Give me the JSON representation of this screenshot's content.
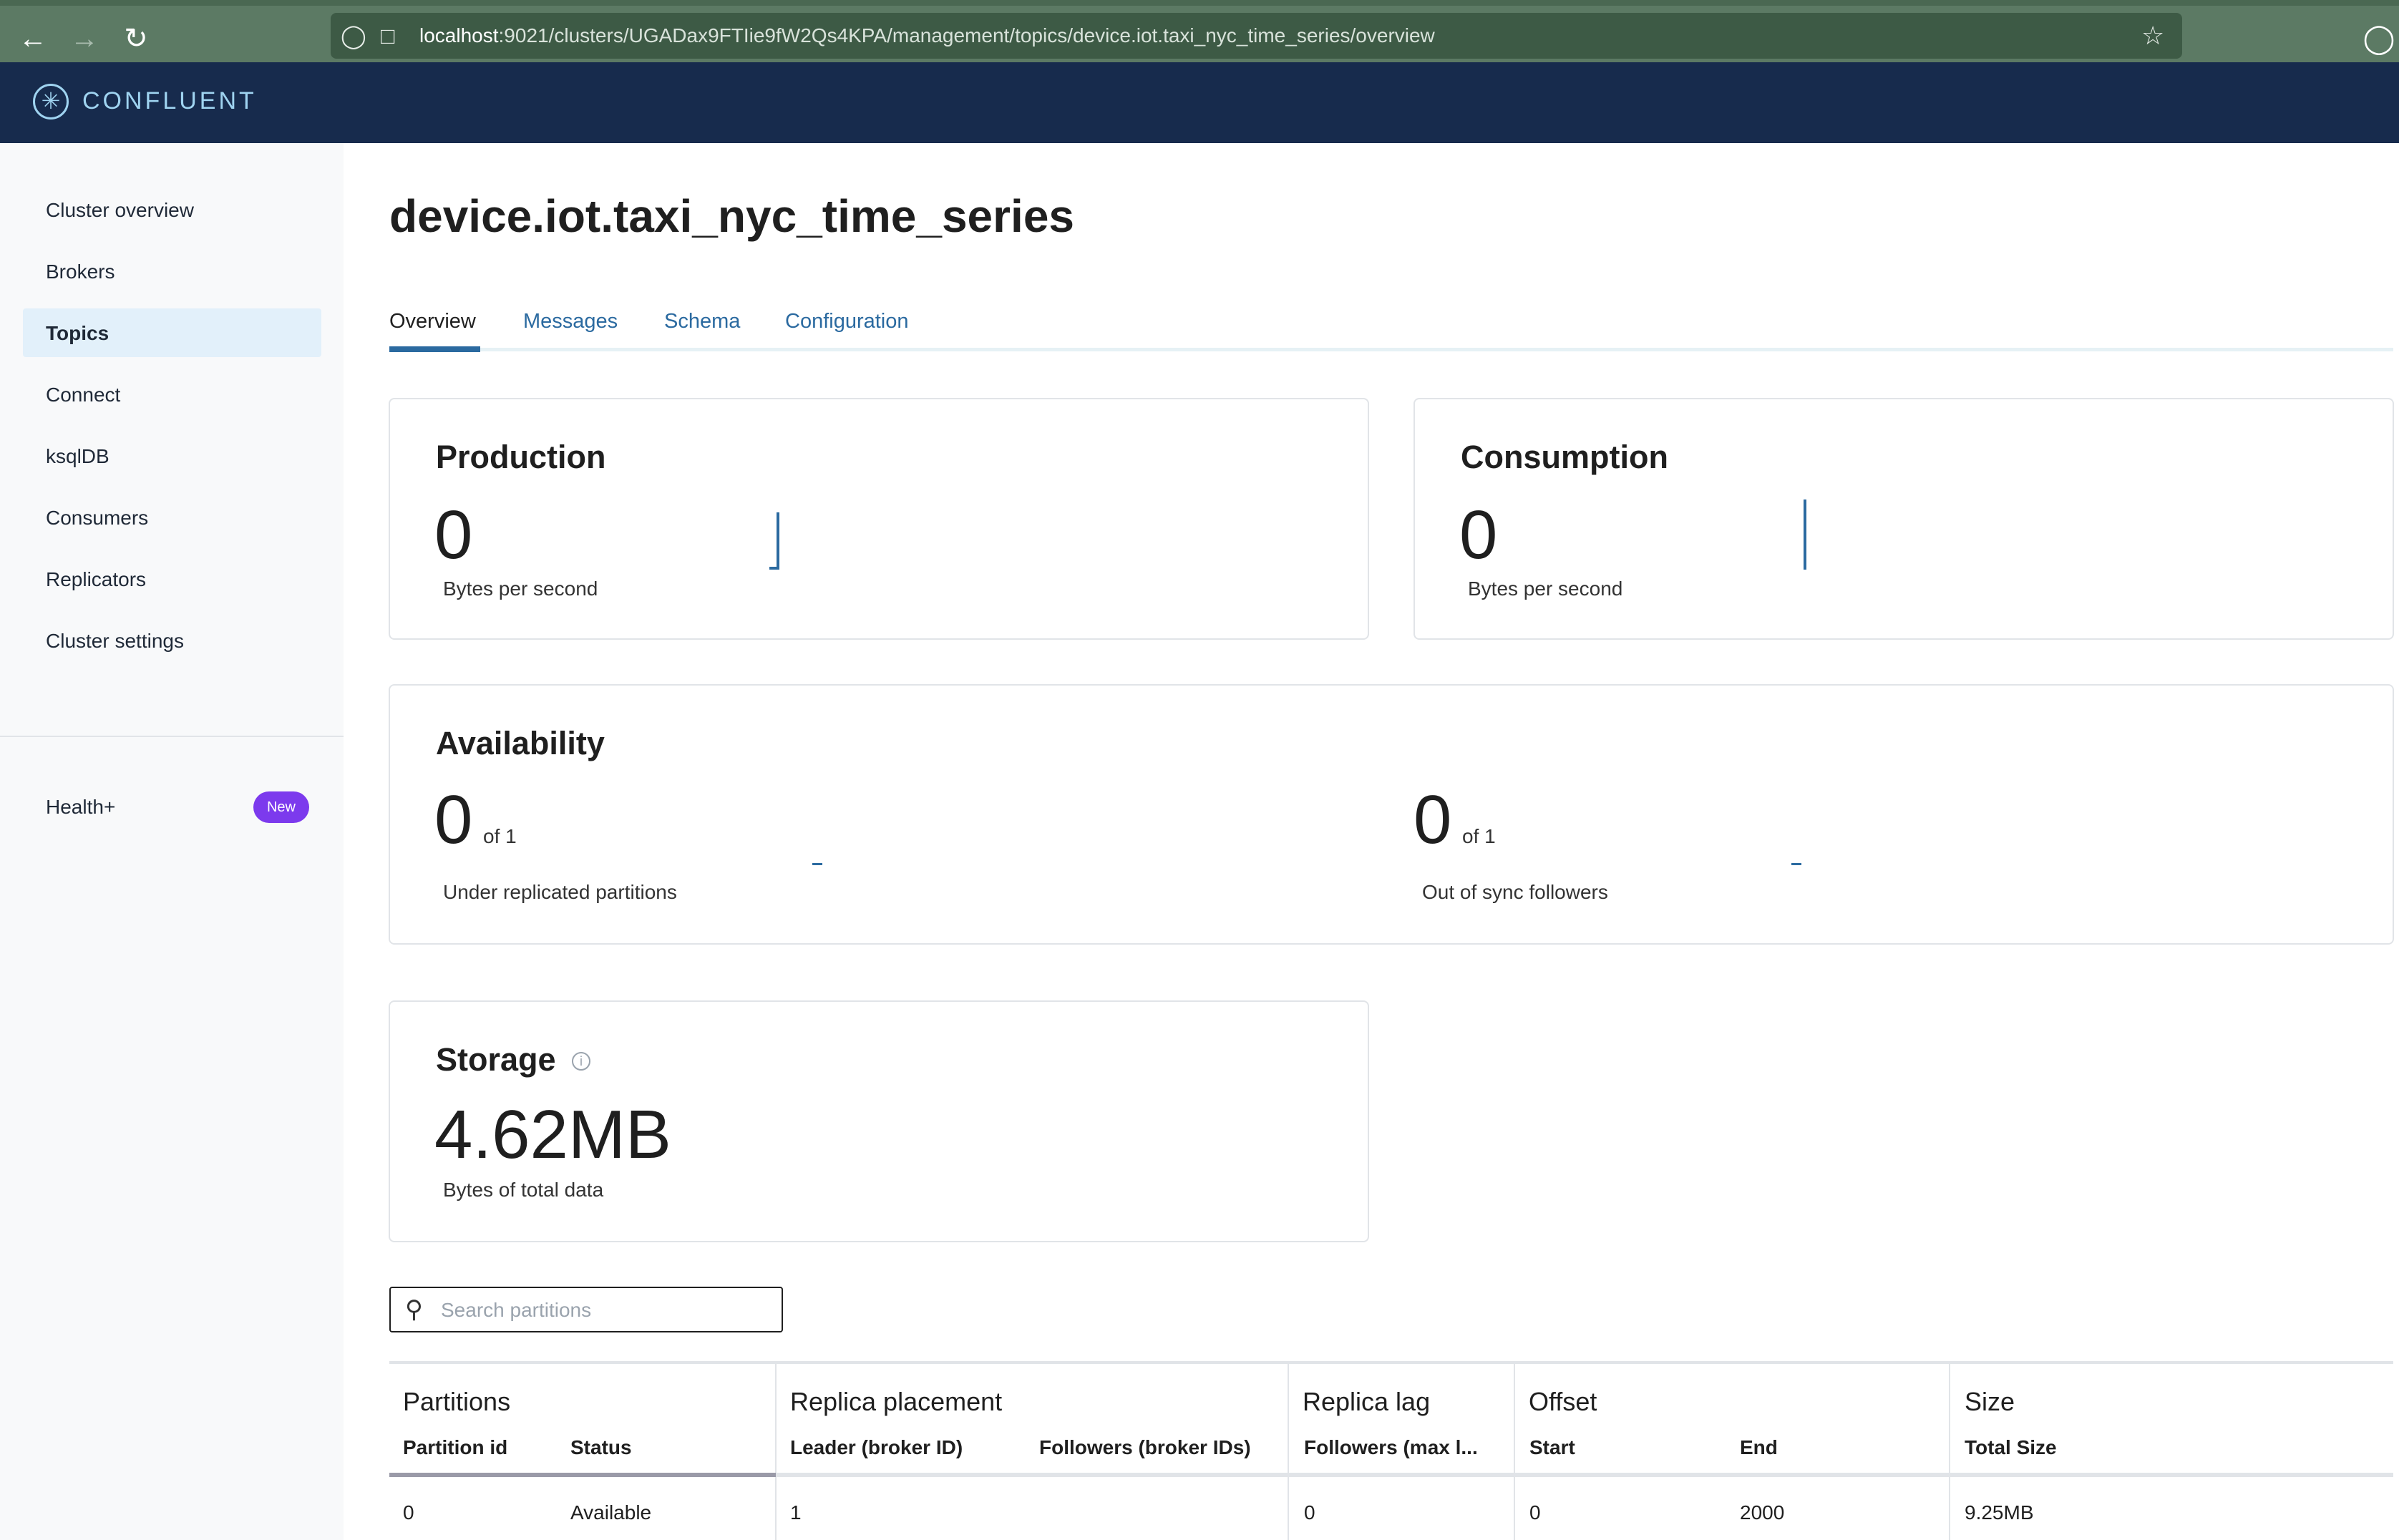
{
  "browser": {
    "url_host": "localhost",
    "url_rest": ":9021/clusters/UGADax9FTIie9fW2Qs4KPA/management/topics/device.iot.taxi_nyc_time_series/overview"
  },
  "header": {
    "brand": "CONFLUENT"
  },
  "sidebar": {
    "items": [
      {
        "label": "Cluster overview"
      },
      {
        "label": "Brokers"
      },
      {
        "label": "Topics",
        "active": true
      },
      {
        "label": "Connect"
      },
      {
        "label": "ksqlDB"
      },
      {
        "label": "Consumers"
      },
      {
        "label": "Replicators"
      },
      {
        "label": "Cluster settings"
      }
    ],
    "health": {
      "label": "Health+",
      "badge": "New"
    }
  },
  "page": {
    "title": "device.iot.taxi_nyc_time_series",
    "tabs": [
      {
        "label": "Overview",
        "active": true
      },
      {
        "label": "Messages"
      },
      {
        "label": "Schema"
      },
      {
        "label": "Configuration"
      }
    ]
  },
  "production": {
    "title": "Production",
    "value": "0",
    "label": "Bytes per second"
  },
  "consumption": {
    "title": "Consumption",
    "value": "0",
    "label": "Bytes per second"
  },
  "availability": {
    "title": "Availability",
    "under_replicated": {
      "value": "0",
      "of": "of 1",
      "label": "Under replicated partitions"
    },
    "out_of_sync": {
      "value": "0",
      "of": "of 1",
      "label": "Out of sync followers"
    }
  },
  "storage": {
    "title": "Storage",
    "value": "4.62MB",
    "label": "Bytes of total data"
  },
  "search": {
    "placeholder": "Search partitions"
  },
  "table": {
    "groups": [
      "Partitions",
      "Replica placement",
      "Replica lag",
      "Offset",
      "Size"
    ],
    "columns": [
      "Partition id",
      "Status",
      "Leader (broker ID)",
      "Followers (broker IDs)",
      "Followers (max l...",
      "Start",
      "End",
      "Total Size"
    ],
    "rows": [
      [
        "0",
        "Available",
        "1",
        "",
        "0",
        "0",
        "2000",
        "9.25MB"
      ]
    ]
  },
  "colors": {
    "header_bg": "#172b4d",
    "accent": "#2b6aa0",
    "badge": "#7c3aed"
  }
}
